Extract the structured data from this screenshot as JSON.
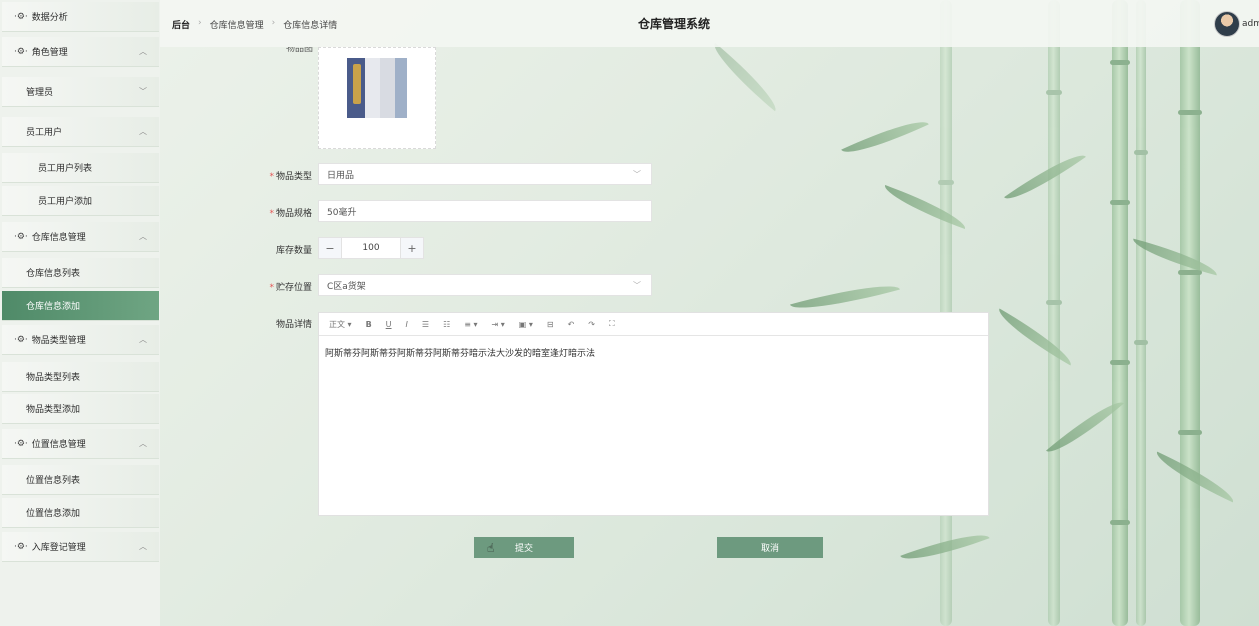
{
  "header": {
    "breadcrumbs": [
      "后台",
      "仓库信息管理",
      "仓库信息详情"
    ],
    "title": "仓库管理系统",
    "username": "adm"
  },
  "sidebar": {
    "items": [
      {
        "label": "数据分析",
        "icon": "settings-icon",
        "level": 1
      },
      {
        "label": "角色管理",
        "icon": "settings-icon",
        "level": 1,
        "arrow": "up"
      },
      {
        "label": "管理员",
        "level": 2,
        "arrow": "down"
      },
      {
        "label": "员工用户",
        "level": 2,
        "arrow": "up"
      },
      {
        "label": "员工用户列表",
        "level": 3
      },
      {
        "label": "员工用户添加",
        "level": 3
      },
      {
        "label": "仓库信息管理",
        "icon": "settings-icon",
        "level": 1,
        "arrow": "up"
      },
      {
        "label": "仓库信息列表",
        "level": 2
      },
      {
        "label": "仓库信息添加",
        "level": 2,
        "active": true
      },
      {
        "label": "物品类型管理",
        "icon": "settings-icon",
        "level": 1,
        "arrow": "up"
      },
      {
        "label": "物品类型列表",
        "level": 2
      },
      {
        "label": "物品类型添加",
        "level": 2
      },
      {
        "label": "位置信息管理",
        "icon": "settings-icon",
        "level": 1,
        "arrow": "up"
      },
      {
        "label": "位置信息列表",
        "level": 2
      },
      {
        "label": "位置信息添加",
        "level": 2
      },
      {
        "label": "入库登记管理",
        "icon": "settings-icon",
        "level": 1,
        "arrow": "up"
      }
    ]
  },
  "form": {
    "image_label_partial": "物品图",
    "item_type": {
      "label": "物品类型",
      "value": "日用品"
    },
    "item_spec": {
      "label": "物品规格",
      "value": "50毫升"
    },
    "stock": {
      "label": "库存数量",
      "value": "100",
      "minus": "−",
      "plus": "+"
    },
    "location": {
      "label": "贮存位置",
      "value": "C区a货架"
    },
    "details": {
      "label": "物品详情",
      "toolbar": [
        "正文 ▾",
        "B",
        "U",
        "I",
        "☰",
        "☷",
        "≡ ▾",
        "⇥ ▾",
        "▣ ▾",
        "⊟",
        "↶",
        "↷",
        "⛶"
      ],
      "content": "阿斯蒂芬阿斯蒂芬阿斯蒂芬阿斯蒂芬暗示法大沙发的暗室逢灯暗示法"
    },
    "submit": "提交",
    "cancel": "取消"
  },
  "colors": {
    "accent": "#6d9a7f",
    "active_menu": "#4f8a68",
    "required": "#e45656"
  }
}
